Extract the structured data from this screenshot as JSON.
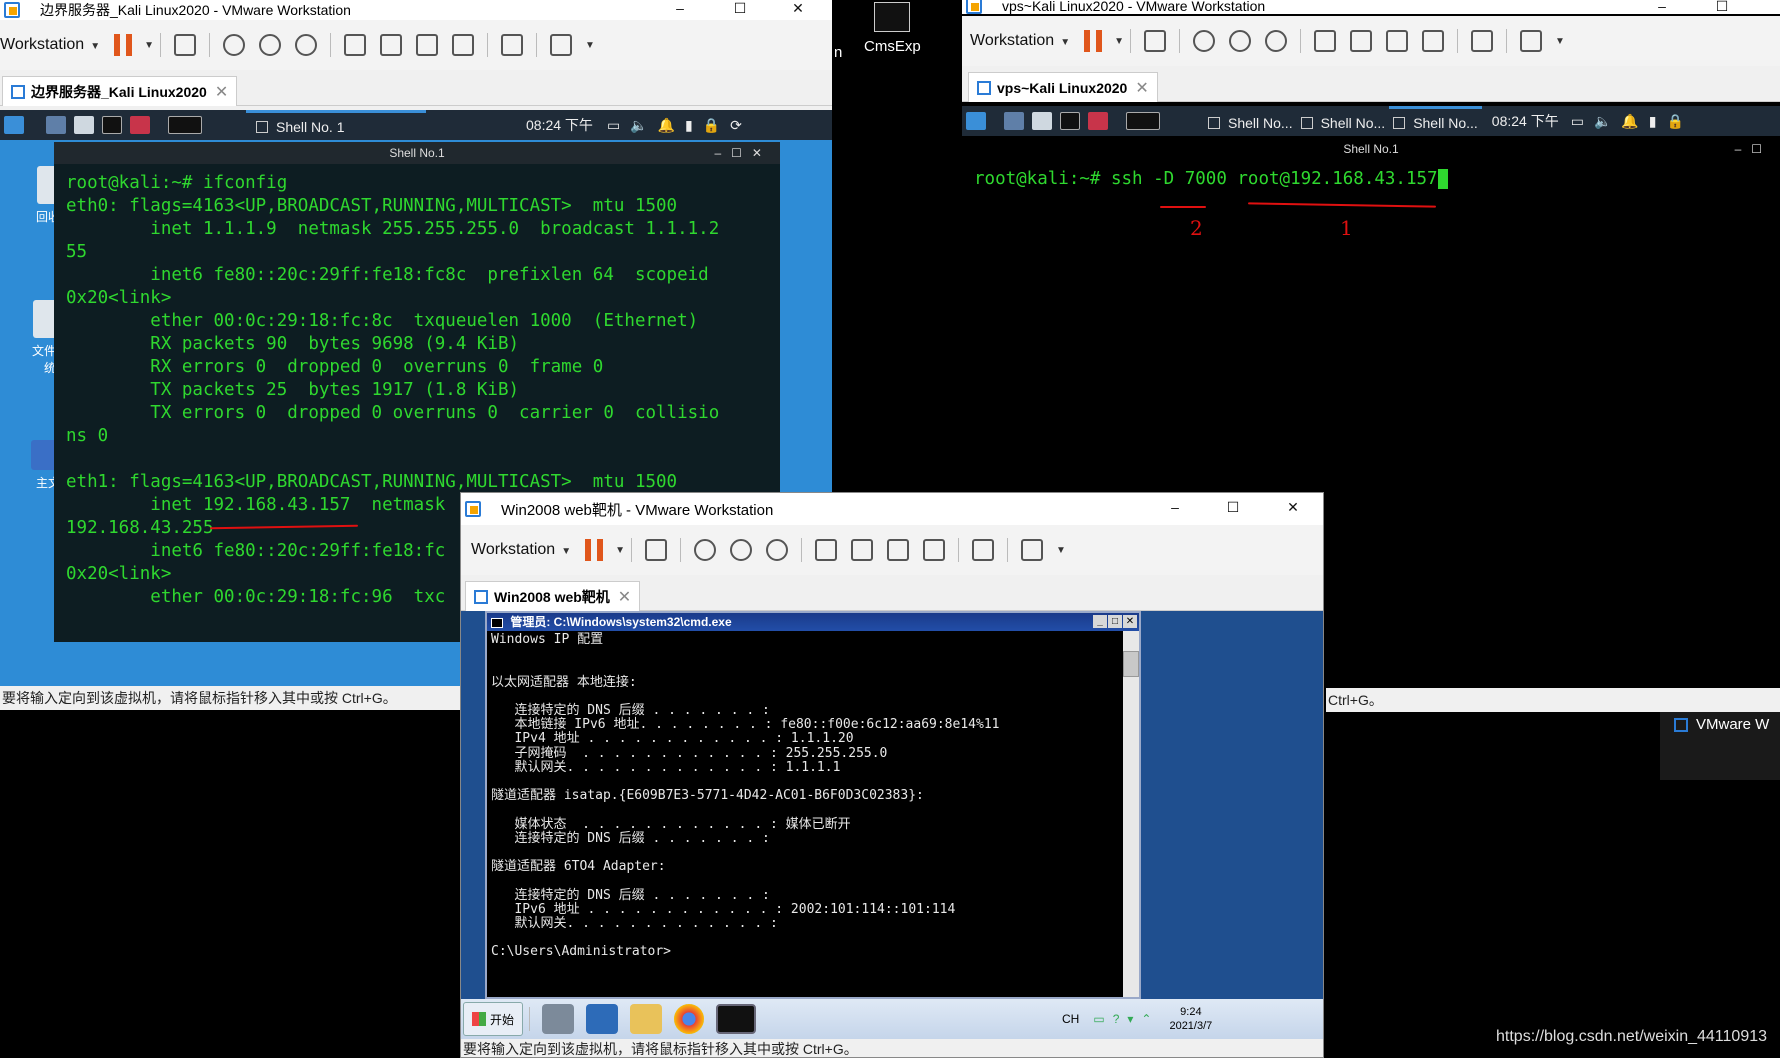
{
  "win1": {
    "title": "边界服务器_Kali Linux2020 - VMware Workstation",
    "menu": "Workstation",
    "tab": "边界服务器_Kali Linux2020",
    "panel_shell": "Shell No. 1",
    "panel_time": "08:24 下午",
    "term_title": "Shell No.1",
    "desktop_labels": [
      "回收站",
      "文件系统",
      "主文"
    ],
    "status": "要将输入定向到该虚拟机，请将鼠标指针移入其中或按 Ctrl+G。",
    "terminal_lines": [
      "root@kali:~# ifconfig",
      "eth0: flags=4163<UP,BROADCAST,RUNNING,MULTICAST>  mtu 1500",
      "        inet 1.1.1.9  netmask 255.255.255.0  broadcast 1.1.1.2",
      "55",
      "        inet6 fe80::20c:29ff:fe18:fc8c  prefixlen 64  scopeid",
      "0x20<link>",
      "        ether 00:0c:29:18:fc:8c  txqueuelen 1000  (Ethernet)",
      "        RX packets 90  bytes 9698 (9.4 KiB)",
      "        RX errors 0  dropped 0  overruns 0  frame 0",
      "        TX packets 25  bytes 1917 (1.8 KiB)",
      "        TX errors 0  dropped 0 overruns 0  carrier 0  collisio",
      "ns 0",
      "",
      "eth1: flags=4163<UP,BROADCAST,RUNNING,MULTICAST>  mtu 1500",
      "        inet 192.168.43.157  netmask",
      "192.168.43.255",
      "        inet6 fe80::20c:29ff:fe18:fc",
      "0x20<link>",
      "        ether 00:0c:29:18:fc:96  txc"
    ]
  },
  "win2": {
    "title": "vps~Kali Linux2020 - VMware Workstation",
    "menu": "Workstation",
    "tab": "vps~Kali Linux2020",
    "panel_shells": [
      "Shell No...",
      "Shell No...",
      "Shell No..."
    ],
    "panel_time": "08:24 下午",
    "term_title": "Shell No.1",
    "command": "root@kali:~# ssh -D 7000 root@192.168.43.157",
    "annotation_1": "1",
    "annotation_2": "2",
    "status": "Ctrl+G。"
  },
  "win3": {
    "title": "Win2008 web靶机 - VMware Workstation",
    "menu": "Workstation",
    "tab": "Win2008 web靶机",
    "cmd_title": "管理员: C:\\Windows\\system32\\cmd.exe",
    "cmd_lines": [
      "Windows IP 配置",
      "",
      "",
      "以太网适配器 本地连接:",
      "",
      "   连接特定的 DNS 后缀 . . . . . . . :",
      "   本地链接 IPv6 地址. . . . . . . . : fe80::f00e:6c12:aa69:8e14%11",
      "   IPv4 地址 . . . . . . . . . . . . : 1.1.1.20",
      "   子网掩码  . . . . . . . . . . . . : 255.255.255.0",
      "   默认网关. . . . . . . . . . . . . : 1.1.1.1",
      "",
      "隧道适配器 isatap.{E609B7E3-5771-4D42-AC01-B6F0D3C02383}:",
      "",
      "   媒体状态  . . . . . . . . . . . . : 媒体已断开",
      "   连接特定的 DNS 后缀 . . . . . . . :",
      "",
      "隧道适配器 6TO4 Adapter:",
      "",
      "   连接特定的 DNS 后缀 . . . . . . . :",
      "   IPv6 地址 . . . . . . . . . . . . : 2002:101:114::101:114",
      "   默认网关. . . . . . . . . . . . . :",
      "",
      "C:\\Users\\Administrator>"
    ],
    "start": "开始",
    "ime": "CH",
    "clock_time": "9:24",
    "clock_date": "2021/3/7",
    "status": "要将输入定向到该虚拟机，请将鼠标指针移入其中或按 Ctrl+G。"
  },
  "desktop_icon": "CmsExp",
  "desktop_partial": "n",
  "vmware_task": "VMware W",
  "watermark": "https://blog.csdn.net/weixin_44110913",
  "colors": {
    "term_green": "#2fd82f",
    "kali_panel": "#1f2b38",
    "annotation": "#e01010"
  }
}
